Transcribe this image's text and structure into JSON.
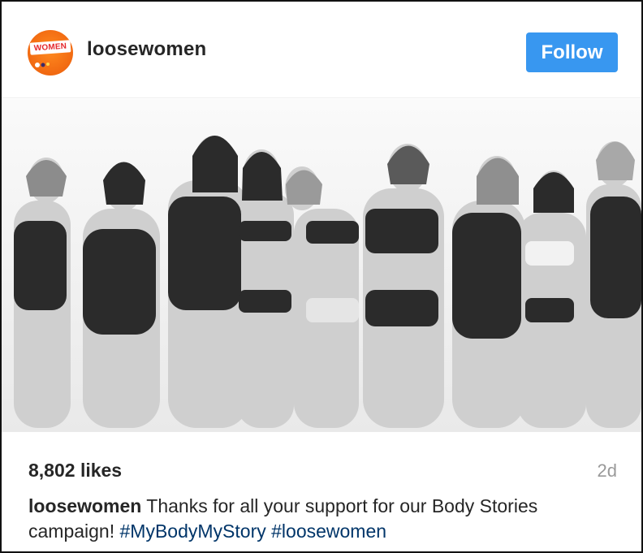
{
  "post": {
    "username": "loosewomen",
    "avatar_text": "WOMEN",
    "follow_label": "Follow",
    "likes": "8,802 likes",
    "time_ago": "2d",
    "caption_user": "loosewomen",
    "caption_text": " Thanks for all your support for our Body Stories campaign! ",
    "hashtags": [
      "#MyBodyMyStory",
      "#loosewomen"
    ]
  },
  "colors": {
    "follow_button": "#3897f0",
    "hashtag": "#003569",
    "text": "#262626",
    "muted": "#999999",
    "avatar": "#f26b12"
  },
  "icons": {
    "avatar": "loose-women-logo"
  }
}
